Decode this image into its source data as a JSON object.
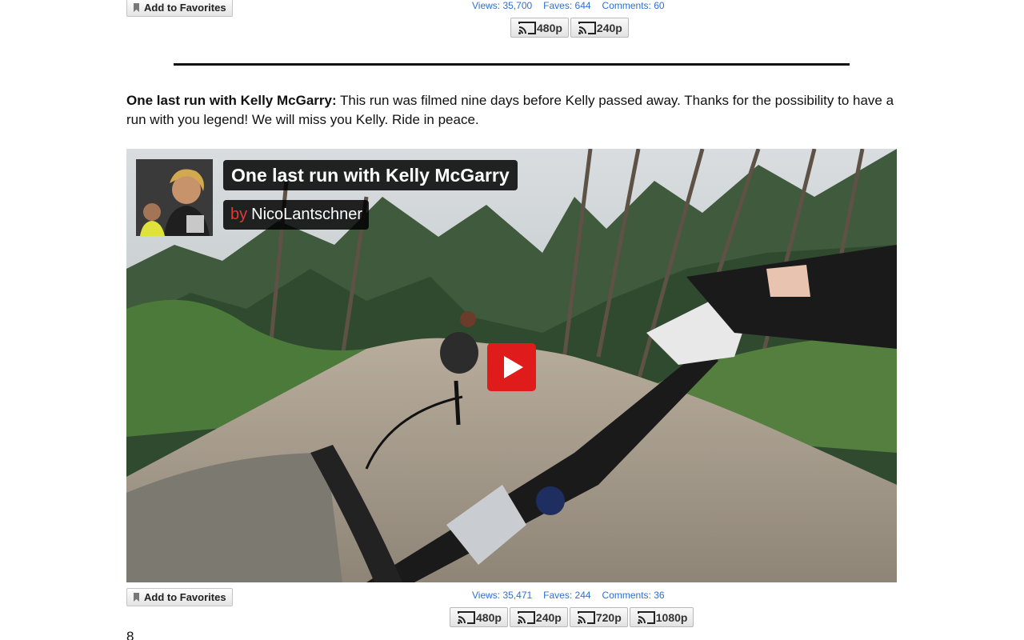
{
  "top_entry": {
    "favorite_label": "Add to Favorites",
    "stats": {
      "views": "Views: 35,700",
      "faves": "Faves: 644",
      "comments": "Comments: 60"
    },
    "resolutions": [
      "480p",
      "240p"
    ]
  },
  "entry": {
    "title": "One last run with Kelly McGarry:",
    "description": " This run was filmed nine days before Kelly passed away. Thanks for the possibility to have a run with you legend! We will miss you Kelly. Ride in peace.",
    "video": {
      "title": "One last run with Kelly McGarry",
      "by_word": "by",
      "channel": "NicoLantschner"
    },
    "favorite_label": "Add to Favorites",
    "stats": {
      "views": "Views: 35,471",
      "faves": "Faves: 244",
      "comments": "Comments: 36"
    },
    "resolutions": [
      "480p",
      "240p",
      "720p",
      "1080p"
    ]
  },
  "next_entry_number": "8",
  "colors": {
    "link": "#2f6fd0",
    "play": "#e01b1b",
    "by": "#e53935"
  },
  "icons": {
    "bookmark": "bookmark-icon",
    "cast": "cast-icon",
    "play": "play-icon"
  }
}
